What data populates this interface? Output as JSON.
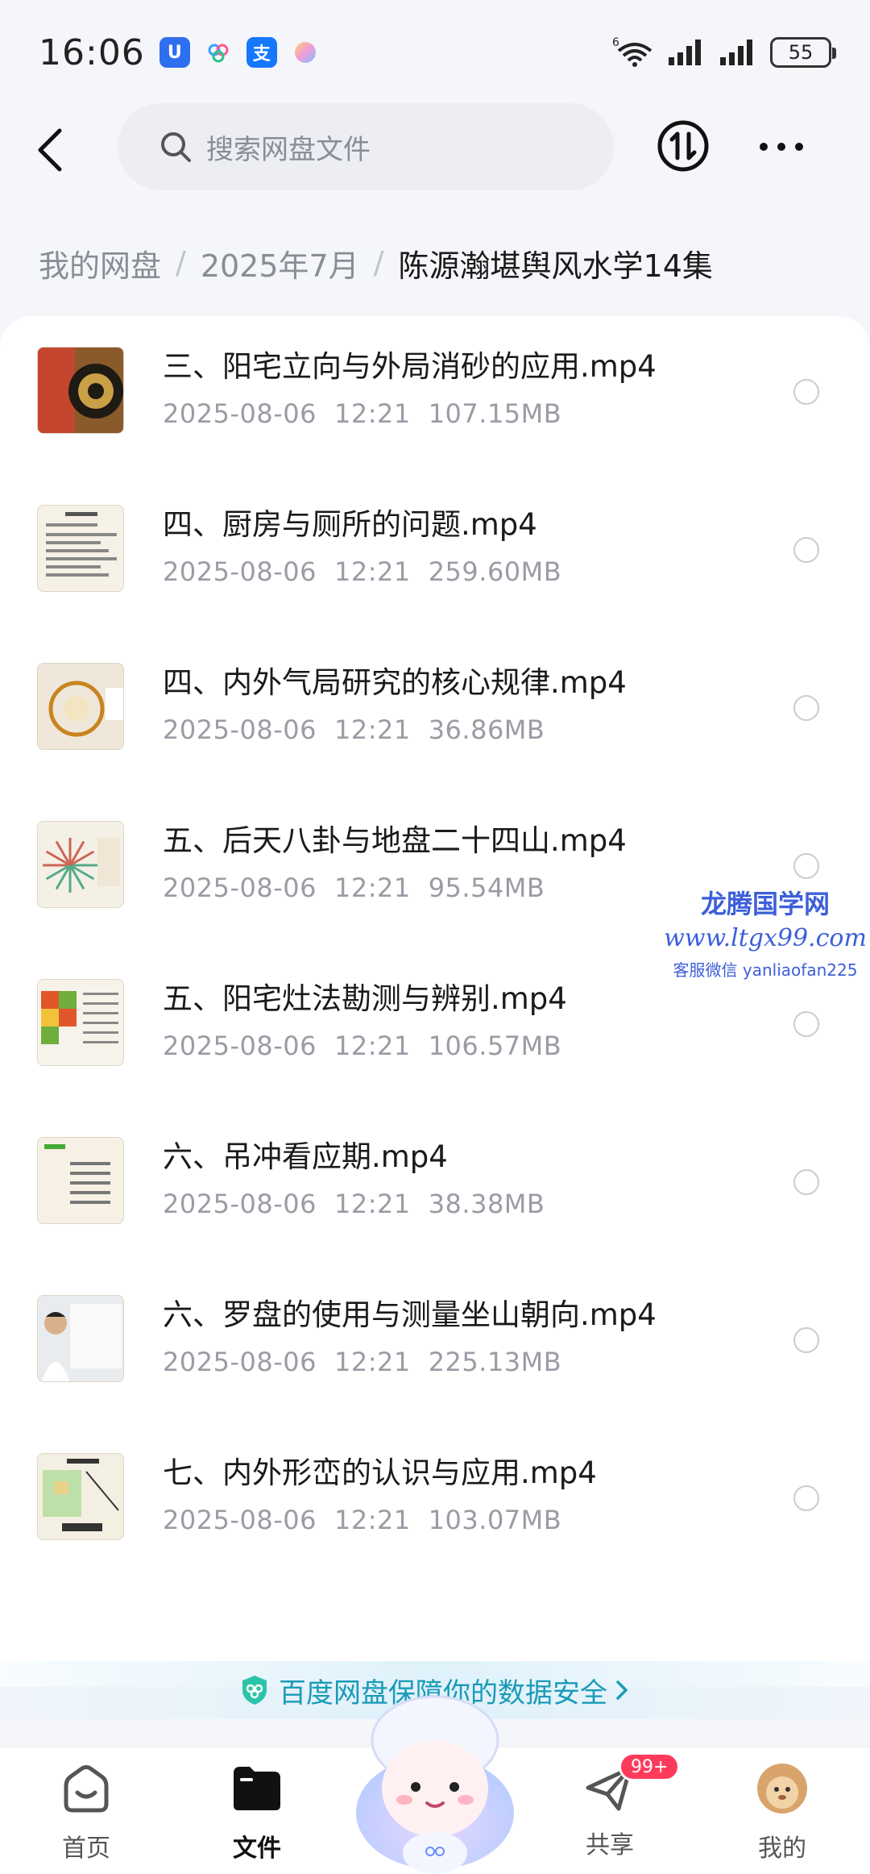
{
  "status_bar": {
    "time": "16:06",
    "app_icons": [
      {
        "name": "shield-app-icon",
        "color": "#2e6ff0",
        "glyph": "U"
      },
      {
        "name": "cloud-app-icon",
        "color": "#ffffff",
        "glyph": ""
      },
      {
        "name": "alipay-app-icon",
        "color": "#1677ff",
        "glyph": "支"
      },
      {
        "name": "gradient-app-icon",
        "color": "#f0c8e8",
        "glyph": ""
      }
    ],
    "battery": "55",
    "wifi_label": "6"
  },
  "header": {
    "search_placeholder": "搜索网盘文件"
  },
  "breadcrumb": {
    "items": [
      "我的网盘",
      "2025年7月"
    ],
    "current": "陈源瀚堪舆风水学14集"
  },
  "files": [
    {
      "name": "三、阳宅立向与外局消砂的应用.mp4",
      "date": "2025-08-06",
      "time": "12:21",
      "size": "107.15MB",
      "thumb": "compass"
    },
    {
      "name": "四、厨房与厕所的问题.mp4",
      "date": "2025-08-06",
      "time": "12:21",
      "size": "259.60MB",
      "thumb": "text"
    },
    {
      "name": "四、内外气局研究的核心规律.mp4",
      "date": "2025-08-06",
      "time": "12:21",
      "size": "36.86MB",
      "thumb": "circle"
    },
    {
      "name": "五、后天八卦与地盘二十四山.mp4",
      "date": "2025-08-06",
      "time": "12:21",
      "size": "95.54MB",
      "thumb": "bagua"
    },
    {
      "name": "五、阳宅灶法勘测与辨别.mp4",
      "date": "2025-08-06",
      "time": "12:21",
      "size": "106.57MB",
      "thumb": "blocks"
    },
    {
      "name": "六、吊冲看应期.mp4",
      "date": "2025-08-06",
      "time": "12:21",
      "size": "38.38MB",
      "thumb": "text2"
    },
    {
      "name": "六、罗盘的使用与测量坐山朝向.mp4",
      "date": "2025-08-06",
      "time": "12:21",
      "size": "225.13MB",
      "thumb": "person"
    },
    {
      "name": "七、内外形峦的认识与应用.mp4",
      "date": "2025-08-06",
      "time": "12:21",
      "size": "103.07MB",
      "thumb": "map"
    }
  ],
  "watermark": {
    "title": "龙腾国学网",
    "url": "www.ltgx99.com",
    "contact": "客服微信 yanliaofan225"
  },
  "security_banner": {
    "text": "百度网盘保障你的数据安全",
    "color": "#1a9bb8"
  },
  "tabs": [
    {
      "label": "首页",
      "icon": "home-icon",
      "active": false
    },
    {
      "label": "文件",
      "icon": "folder-icon",
      "active": true
    },
    {
      "label": "共享",
      "icon": "share-icon",
      "active": false,
      "badge": "99+"
    },
    {
      "label": "我的",
      "icon": "avatar-icon",
      "active": false
    }
  ],
  "colors": {
    "accent": "#3d5fd9",
    "badge": "#ff3b5c",
    "muted_text": "#9a9ca5"
  }
}
